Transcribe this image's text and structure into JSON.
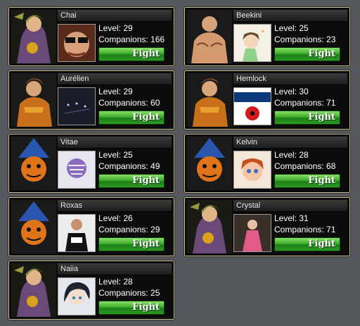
{
  "cards": [
    {
      "name": "Chai",
      "level": "Level: 29",
      "companions": "Companions: 166",
      "fight": "Fight",
      "portrait": "warrior-woman-portrait",
      "avatar": "sunglasses-photo-avatar"
    },
    {
      "name": "Beekini",
      "level": "Level: 25",
      "companions": "Companions: 23",
      "fight": "Fight",
      "portrait": "bald-brawler-portrait",
      "avatar": "anime-girl-avatar"
    },
    {
      "name": "Aurélien",
      "level": "Level: 29",
      "companions": "Companions: 60",
      "fight": "Fight",
      "portrait": "armored-knight-portrait",
      "avatar": "dark-lights-avatar"
    },
    {
      "name": "Hemlock",
      "level": "Level: 30",
      "companions": "Companions: 71",
      "fight": "Fight",
      "portrait": "armored-knight-portrait",
      "avatar": "legion-poppy-avatar"
    },
    {
      "name": "Vitae",
      "level": "Level: 25",
      "companions": "Companions: 49",
      "fight": "Fight",
      "portrait": "pumpkin-wizard-portrait",
      "avatar": "skull-robot-avatar"
    },
    {
      "name": "Kelvin",
      "level": "Level: 28",
      "companions": "Companions: 68",
      "fight": "Fight",
      "portrait": "pumpkin-wizard-portrait",
      "avatar": "cartoon-girl-avatar"
    },
    {
      "name": "Roxas",
      "level": "Level: 26",
      "companions": "Companions: 29",
      "fight": "Fight",
      "portrait": "pumpkin-wizard-portrait",
      "avatar": "run-bkn-shirt-avatar"
    },
    {
      "name": "Crystal",
      "level": "Level: 31",
      "companions": "Companions: 71",
      "fight": "Fight",
      "portrait": "warrior-woman-portrait",
      "avatar": "pink-dress-girl-avatar"
    },
    {
      "name": "Naiia",
      "level": "Level: 28",
      "companions": "Companions: 25",
      "fight": "Fight",
      "portrait": "warrior-woman-portrait",
      "avatar": "dark-hair-anime-avatar"
    }
  ],
  "colors": {
    "background": "#55595d",
    "card_border": "#d8c98a",
    "fight_green": "#3fae2d"
  }
}
